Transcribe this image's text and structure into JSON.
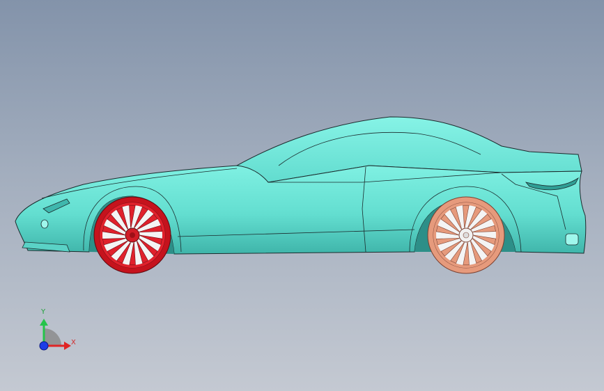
{
  "viewport": {
    "background_top": "#8393aa",
    "background_bottom": "#c4c9d2"
  },
  "model": {
    "body_color": "#6fe3d6",
    "body_shadow": "#3fb7ad",
    "edge_color": "#1b2a2c",
    "front_wheel_color": "#e0212c",
    "rear_wheel_color": "#e69a7c"
  },
  "triad": {
    "y_label": "Y",
    "x_label": "X",
    "y_color": "#25c44a",
    "x_color": "#e02525",
    "z_color": "#1d3de6"
  }
}
